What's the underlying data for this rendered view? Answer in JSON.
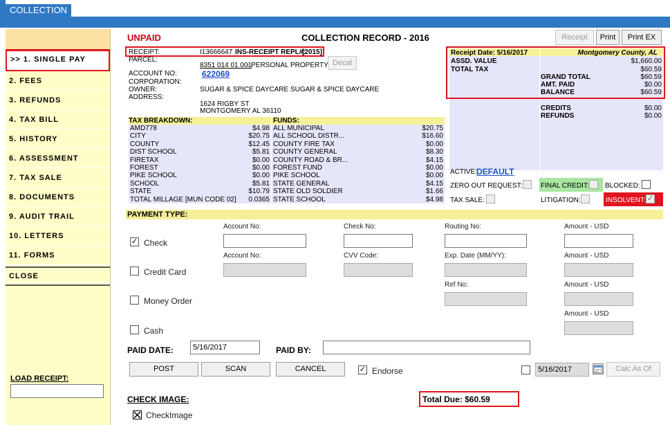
{
  "window": {
    "tab": "COLLECTION"
  },
  "sidebar": {
    "items": [
      {
        "label": ">> 1. SINGLE PAY"
      },
      {
        "label": "2. FEES"
      },
      {
        "label": "3. REFUNDS"
      },
      {
        "label": "4. TAX BILL"
      },
      {
        "label": "5. HISTORY"
      },
      {
        "label": "6. ASSESSMENT"
      },
      {
        "label": "7. TAX SALE"
      },
      {
        "label": "8. DOCUMENTS"
      },
      {
        "label": "9. AUDIT TRAIL"
      },
      {
        "label": "10. LETTERS"
      },
      {
        "label": "11. FORMS"
      },
      {
        "label": "CLOSE"
      }
    ],
    "load_receipt_label": "LOAD RECEIPT:",
    "load_receipt_value": ""
  },
  "record": {
    "status": "UNPAID",
    "title": "COLLECTION RECORD - 2016",
    "buttons": {
      "receipt": "Receipt",
      "print": "Print",
      "print_ex": "Print EX",
      "decal": "Decal"
    },
    "receipt_label": "RECEIPT:",
    "receipt_value": "I13666647",
    "ins_label": "INS-RECEIPT REPL#:",
    "ins_value": "[2015]",
    "parcel_label": "PARCEL:",
    "parcel_value": "8351 014 01 001",
    "parcel_type": " - PERSONAL PROPERTY",
    "account_label": "ACCOUNT NO:",
    "account_value": "622069",
    "corporation_label": "CORPORATION:",
    "owner_label": "OWNER:",
    "owner_value": "SUGAR & SPICE DAYCARE SUGAR & SPICE DAYCARE",
    "address_label": "ADDRESS:",
    "address_line1": "1624 RIGBY ST",
    "address_line2": "MONTGOMERY AL  36110"
  },
  "tax_breakdown": {
    "header": "TAX BREAKDOWN:",
    "rows": [
      {
        "name": "AMD778",
        "value": "$4.98"
      },
      {
        "name": "CITY",
        "value": "$20.75"
      },
      {
        "name": "COUNTY",
        "value": "$12.45"
      },
      {
        "name": "DIST SCHOOL",
        "value": "$5.81"
      },
      {
        "name": "FIRETAX",
        "value": "$0.00"
      },
      {
        "name": "FOREST",
        "value": "$0.00"
      },
      {
        "name": "PIKE SCHOOL",
        "value": "$0.00"
      },
      {
        "name": "SCHOOL",
        "value": "$5.81"
      },
      {
        "name": "STATE",
        "value": "$10.79"
      },
      {
        "name": "TOTAL MILLAGE [MUN CODE 02]",
        "value": "0.0365"
      }
    ]
  },
  "funds": {
    "header": "FUNDS:",
    "rows": [
      {
        "name": "ALL MUNICIPAL",
        "value": "$20.75"
      },
      {
        "name": "ALL SCHOOL DISTR...",
        "value": "$16.60"
      },
      {
        "name": "COUNTY FIRE TAX",
        "value": "$0.00"
      },
      {
        "name": "COUNTY GENERAL",
        "value": "$8.30"
      },
      {
        "name": "COUNTY ROAD & BR...",
        "value": "$4.15"
      },
      {
        "name": "FOREST FUND",
        "value": "$0.00"
      },
      {
        "name": "PIKE SCHOOL",
        "value": "$0.00"
      },
      {
        "name": "STATE GENERAL",
        "value": "$4.15"
      },
      {
        "name": "STATE OLD SOLDIER",
        "value": "$1.66"
      },
      {
        "name": "STATE SCHOOL",
        "value": "$4.98"
      }
    ]
  },
  "summary": {
    "receipt_date": "Receipt Date: 5/16/2017",
    "county": "Montgomery County, AL",
    "assd_label": "ASSD. VALUE",
    "assd_value": "$1,660.00",
    "total_tax_label": "TOTAL TAX",
    "total_tax_value": "$60.59",
    "grand_total_label": "GRAND TOTAL",
    "grand_total_value": "$60.59",
    "amt_paid_label": "AMT. PAID",
    "amt_paid_value": "$0.00",
    "balance_label": "BALANCE",
    "balance_value": "$60.59",
    "credits_label": "CREDITS",
    "credits_value": "$0.00",
    "refunds_label": "REFUNDS",
    "refunds_value": "$0.00",
    "active_label": "ACTIVE:",
    "active_value": "DEFAULT",
    "zero_out_label": "ZERO OUT REQUEST:",
    "final_credit_label": "FINAL CREDIT:",
    "blocked_label": "BLOCKED:",
    "tax_sale_label": "TAX SALE:",
    "litigation_label": "LITIGATION:",
    "insolvent_label": "INSOLVENT:"
  },
  "payment": {
    "header": "PAYMENT TYPE:",
    "check_label": "Check",
    "credit_label": "Credit Card",
    "money_order_label": "Money Order",
    "cash_label": "Cash",
    "account_no_label": "Account No:",
    "check_no_label": "Check No:",
    "routing_no_label": "Routing No:",
    "amount_label": "Amount - USD",
    "cvv_label": "CVV Code:",
    "exp_label": "Exp. Date (MM/YY):",
    "ref_label": "Ref No:",
    "paid_date_label": "PAID DATE:",
    "paid_date_value": "5/16/2017",
    "paid_by_label": "PAID BY:",
    "paid_by_value": "",
    "post": "POST",
    "scan": "SCAN",
    "cancel": "CANCEL",
    "endorse": "Endorse",
    "calc_date": "5/16/2017",
    "calc_as_of": "Calc As Of",
    "check_image_label": "CHECK IMAGE:",
    "checkimage_label": "CheckImage",
    "total_due": "Total Due: $60.59"
  },
  "colors": {
    "brand": "#2f78c4",
    "alert": "#e0141e",
    "sidebar": "#fffec8",
    "lavender": "#e6e6fa",
    "yellow": "#f5f099"
  }
}
